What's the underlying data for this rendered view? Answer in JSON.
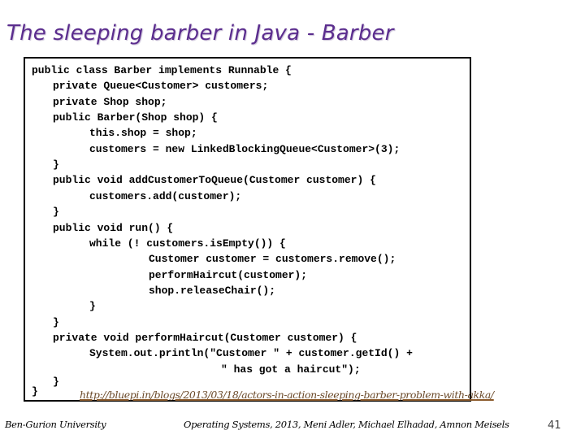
{
  "slide": {
    "title": "The sleeping barber in Java - Barber",
    "code_lines": [
      {
        "indent": 0,
        "text": "public class Barber implements Runnable {"
      },
      {
        "indent": 1,
        "text": "private Queue<Customer> customers;"
      },
      {
        "indent": 1,
        "text": "private Shop shop;"
      },
      {
        "indent": 1,
        "text": "public Barber(Shop shop) {"
      },
      {
        "indent": 2,
        "text": "this.shop = shop;"
      },
      {
        "indent": 2,
        "text": "customers = new LinkedBlockingQueue<Customer>(3);"
      },
      {
        "indent": 1,
        "text": "}"
      },
      {
        "indent": 1,
        "text": "public void addCustomerToQueue(Customer customer) {"
      },
      {
        "indent": 2,
        "text": "customers.add(customer);"
      },
      {
        "indent": 1,
        "text": "}"
      },
      {
        "indent": 1,
        "text": "public void run() {"
      },
      {
        "indent": 2,
        "text": "while (! customers.isEmpty()) {"
      },
      {
        "indent": 3,
        "text": "Customer customer = customers.remove();"
      },
      {
        "indent": 3,
        "text": "performHaircut(customer);"
      },
      {
        "indent": 3,
        "text": "shop.releaseChair();"
      },
      {
        "indent": 2,
        "text": "}"
      },
      {
        "indent": 1,
        "text": "}"
      },
      {
        "indent": 1,
        "text": "private void performHaircut(Customer customer) {"
      },
      {
        "indent": 2,
        "text": "System.out.println(\"Customer \" + customer.getId() +"
      },
      {
        "indent": 4,
        "text": "\" has got a haircut\");"
      },
      {
        "indent": 1,
        "text": "}"
      },
      {
        "indent": 0,
        "text": "}"
      }
    ],
    "link": "http://bluepi.in/blogs/2013/03/18/actors-in-action-sleeping-barber-problem-with-akka/",
    "footer": {
      "left": "Ben-Gurion University",
      "center": "Operating Systems, 2013, Meni Adler, Michael Elhadad, Amnon Meisels",
      "page_number": "41"
    }
  },
  "colors": {
    "title": "#5b2d8e",
    "link": "#6b4a2a"
  }
}
